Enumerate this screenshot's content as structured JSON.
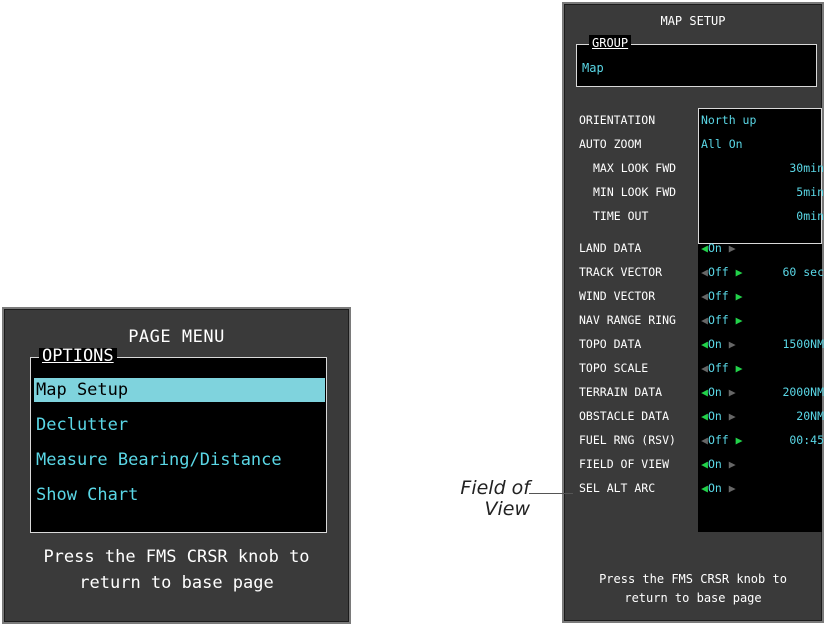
{
  "page_menu": {
    "title": "PAGE MENU",
    "group_label": "OPTIONS",
    "items": [
      {
        "label": "Map Setup",
        "selected": true
      },
      {
        "label": "Declutter",
        "selected": false
      },
      {
        "label": "Measure Bearing/Distance",
        "selected": false
      },
      {
        "label": "Show Chart",
        "selected": false
      }
    ],
    "footer_line1": "Press the FMS CRSR knob to",
    "footer_line2": "return to base page"
  },
  "map_setup": {
    "title": "MAP SETUP",
    "group_label": "GROUP",
    "group_value": "Map",
    "rows": [
      {
        "label": "ORIENTATION",
        "value": "North up",
        "value2": ""
      },
      {
        "label": "AUTO ZOOM",
        "value": "All On",
        "value2": ""
      },
      {
        "label": "MAX LOOK FWD",
        "value": "",
        "value2": "30min"
      },
      {
        "label": "MIN LOOK FWD",
        "value": "",
        "value2": "5min"
      },
      {
        "label": "TIME OUT",
        "value": "",
        "value2": "0min"
      },
      {
        "label": "LAND DATA",
        "value": "On",
        "value2": ""
      },
      {
        "label": "TRACK VECTOR",
        "value": "Off",
        "value2": "60 sec"
      },
      {
        "label": "WIND VECTOR",
        "value": "Off",
        "value2": ""
      },
      {
        "label": "NAV RANGE RING",
        "value": "Off",
        "value2": ""
      },
      {
        "label": "TOPO DATA",
        "value": "On",
        "value2": "1500NM"
      },
      {
        "label": "TOPO SCALE",
        "value": "Off",
        "value2": ""
      },
      {
        "label": "TERRAIN DATA",
        "value": "On",
        "value2": "2000NM"
      },
      {
        "label": "OBSTACLE DATA",
        "value": "On",
        "value2": "20NM"
      },
      {
        "label": "FUEL RNG (RSV)",
        "value": "Off",
        "value2": "00:45"
      },
      {
        "label": "FIELD OF VIEW",
        "value": "On",
        "value2": ""
      },
      {
        "label": "SEL ALT ARC",
        "value": "On",
        "value2": ""
      }
    ],
    "footer_line1": "Press the FMS CRSR knob to",
    "footer_line2": "return to base page"
  },
  "callout": {
    "line1": "Field of",
    "line2": "View"
  },
  "colors": {
    "cyan": "#5ad7e6",
    "green_arrow": "#22d24a",
    "selection": "#7fd3dd",
    "bezel": "#3a3a3a"
  }
}
